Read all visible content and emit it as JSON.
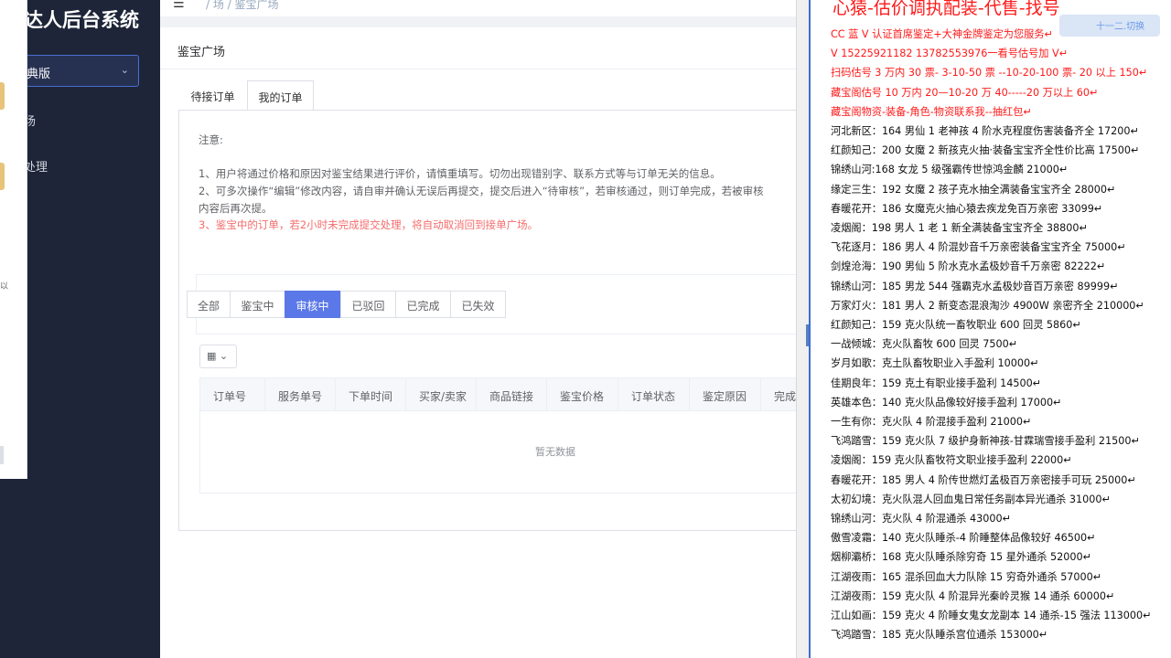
{
  "sidebar": {
    "brand": "达人后台系统",
    "version_label": "典版",
    "items": [
      {
        "label": "场"
      },
      {
        "label": "处理"
      }
    ]
  },
  "popup": {
    "mini_label": "以"
  },
  "header": {
    "breadcrumb": "/  场  /  鉴宝广场"
  },
  "card": {
    "title": "鉴宝广场",
    "tabs": [
      {
        "label": "待接订单"
      },
      {
        "label": "我的订单"
      }
    ],
    "notice_title": "注意:",
    "notices": [
      "1、用户将通过价格和原因对鉴宝结果进行评价，请慎重填写。切勿出现错别字、联系方式等与订单无关的信息。",
      "2、可多次操作“编辑”修改内容，请自审并确认无误后再提交，提交后进入“待审核”，若审核通过，则订单完成，若被审核",
      "内容后再次提。",
      "3、鉴宝中的订单，若2小时未完成提交处理，将自动取消回到接单广场。"
    ],
    "status_filters": [
      {
        "label": "全部"
      },
      {
        "label": "鉴宝中"
      },
      {
        "label": "审核中"
      },
      {
        "label": "已驳回"
      },
      {
        "label": "已完成"
      },
      {
        "label": "已失效"
      }
    ],
    "active_filter": "审核中",
    "columns": [
      "订单号",
      "服务单号",
      "下单时间",
      "买家/卖家",
      "商品链接",
      "鉴宝价格",
      "订单状态",
      "鉴定原因",
      "完成"
    ],
    "empty_text": "暂无数据"
  },
  "doc": {
    "headline": "心猿-估价调执配装-代售-找号",
    "lines": [
      {
        "text": "CC 蓝 V 认证首席鉴定+大神金牌鉴定为您服务↵",
        "red": true
      },
      {
        "text": "V 15225921182      13782553976一看号估号加 V↵",
        "red": true
      },
      {
        "text": "扫码估号 3 万内 30 票- 3-10-50 票  --10-20-100 票- 20 以上 150↵",
        "red": true
      },
      {
        "text": "藏宝阁估号 10 万内 20—10-20 万 40-----20 万以上 60↵",
        "red": true
      },
      {
        "text": "藏宝阁物资-装备-角色-物资联系我--抽红包↵",
        "red": true
      },
      {
        "text": "河北新区：164 男仙 1 老神孩 4 阶水克程度伤害装备齐全 17200↵",
        "red": false
      },
      {
        "text": "红颜知己：200 女魔 2 新孩克火抽·装备宝宝齐全性价比高 17500↵",
        "red": false
      },
      {
        "text": "锦绣山河:168 女龙 5 级强霸传世惊鸿金麟 21000↵",
        "red": false
      },
      {
        "text": "缘定三生：192 女魔 2 孩子克水抽全满装备宝宝齐全 28000↵",
        "red": false
      },
      {
        "text": "春暖花开：186 女魔克火抽心猿去疾龙免百万亲密 33099↵",
        "red": false
      },
      {
        "text": "凌烟阁：198 男人 1 老 1 新全满装备宝宝齐全 38800↵",
        "red": false
      },
      {
        "text": "飞花逐月：186 男人 4 阶混妙音千万亲密装备宝宝齐全 75000↵",
        "red": false
      },
      {
        "text": "剑煌沧海：190 男仙 5 阶水克水孟极妙音千万亲密 82222↵",
        "red": false
      },
      {
        "text": "锦绣山河：185 男龙 544 强霸克水孟极妙音百万亲密 89999↵",
        "red": false
      },
      {
        "text": "万家灯火：181 男人 2 新变态混浪淘沙 4900W 亲密齐全 210000↵",
        "red": false
      },
      {
        "text": "红颜知己：159 克火队统一畜牧职业 600 回灵 5860↵",
        "red": false
      },
      {
        "text": "一战倾城：克火队畜牧 600 回灵 7500↵",
        "red": false
      },
      {
        "text": "岁月如歌：克土队畜牧职业入手盈利 10000↵",
        "red": false
      },
      {
        "text": "佳期良年：159 克土有职业接手盈利 14500↵",
        "red": false
      },
      {
        "text": "英雄本色：140 克火队品像较好接手盈利 17000↵",
        "red": false
      },
      {
        "text": "一生有你：克火队 4 阶混接手盈利 21000↵",
        "red": false
      },
      {
        "text": "飞鸿踏雪：159 克火队 7 级护身新神孩-甘霖瑞雪接手盈利 21500↵",
        "red": false
      },
      {
        "text": "凌烟阁：159 克火队畜牧符文职业接手盈利 22000↵",
        "red": false
      },
      {
        "text": "春暖花开：185 男人 4 阶传世燃灯孟极百万亲密接手可玩 25000↵",
        "red": false
      },
      {
        "text": "太初幻境：克火队混人回血鬼日常任务副本异光通杀 31000↵",
        "red": false
      },
      {
        "text": "锦绣山河：克火队 4 阶混通杀 43000↵",
        "red": false
      },
      {
        "text": "傲雪凌霜：140 克火队睡杀-4 阶睡整体品像较好 46500↵",
        "red": false
      },
      {
        "text": "烟柳灞桥：168 克火队睡杀除穷奇 15 星外通杀 52000↵",
        "red": false
      },
      {
        "text": "江湖夜雨：165 混杀回血大力队除 15 穷奇外通杀 57000↵",
        "red": false
      },
      {
        "text": "江湖夜雨：159 克火队 4 阶混异光秦岭灵猴 14 通杀 60000↵",
        "red": false
      },
      {
        "text": "江山如画：159 克火 4 阶睡女鬼女龙副本 14 通杀-15 强法 113000↵",
        "red": false
      },
      {
        "text": "飞鸿踏雪：185 克火队睡杀宫位通杀 153000↵",
        "red": false
      }
    ],
    "top_label": "十一二.切换"
  },
  "colors": {
    "sidebar_bg": "#1e2538",
    "accent": "#5b78e8",
    "warning_red": "#f56c6c",
    "doc_red": "#ff1a1a"
  }
}
